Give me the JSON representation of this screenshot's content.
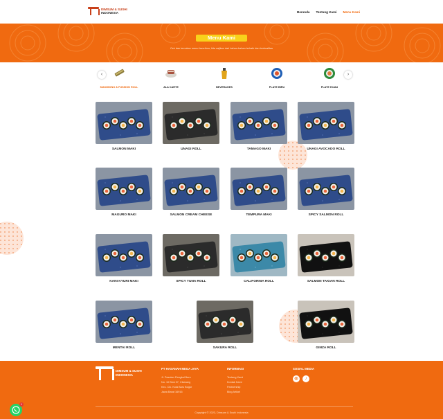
{
  "brand": {
    "line1": "DIMSUM & SUSHI",
    "line2": "INDONESIA"
  },
  "nav": [
    {
      "label": "Beranda",
      "active": false
    },
    {
      "label": "Tentang Kami",
      "active": false
    },
    {
      "label": "Menu Kami",
      "active": true
    }
  ],
  "hero": {
    "title": "Menu Kami",
    "subtitle": "Cek dan temukan menu favoritmu, kita sajikan dari bahan-bahan terbaik dan berkualitas"
  },
  "categories": [
    {
      "label": "MAKIMONO & FUSSION ROLL",
      "icon": "roll-icon",
      "active": true
    },
    {
      "label": "ALA CARTE",
      "icon": "plate-icon",
      "active": false
    },
    {
      "label": "BEVERAGES",
      "icon": "drink-icon",
      "active": false
    },
    {
      "label": "PLATE BIRU",
      "icon": "blue-plate-icon",
      "active": false
    },
    {
      "label": "PLATE HIJAU",
      "icon": "green-plate-icon",
      "active": false
    }
  ],
  "products": [
    {
      "name": "SALMON MAKI",
      "style": "blue"
    },
    {
      "name": "UNAGI ROLL",
      "style": "dark"
    },
    {
      "name": "TAMAGO MAKI",
      "style": "blue"
    },
    {
      "name": "UNAGI AVOCADO ROLL",
      "style": "blue"
    },
    {
      "name": "MAGURO MAKI",
      "style": "blue"
    },
    {
      "name": "SALMON CREAM CHEESE",
      "style": "blue"
    },
    {
      "name": "TEMPURA MAKI",
      "style": "blue"
    },
    {
      "name": "SPICY SALMON ROLL",
      "style": "blue"
    },
    {
      "name": "KANI KYURI MAKI",
      "style": "blue"
    },
    {
      "name": "SPICY TUNA ROLL",
      "style": "dark"
    },
    {
      "name": "CALIFORNIA ROLL",
      "style": "teal"
    },
    {
      "name": "SALMON TAKIAN ROLL",
      "style": "black"
    },
    {
      "name": "MENTAI ROLL",
      "style": "blue"
    },
    {
      "name": "SAKURA ROLL",
      "style": "dark"
    },
    {
      "name": "GINZA ROLL",
      "style": "black"
    }
  ],
  "footer": {
    "brand": {
      "line1": "DIMSUM & SUSHI",
      "line2": "INDONESIA"
    },
    "company": {
      "heading": "PT HASANAH MEGA JAYA",
      "lines": [
        "Jl. Pasutan Pangkal Baru",
        "No. 10 Blok 37, Cikarang",
        "Kec. Cik. Kota Baru Bogor",
        "Jawa Barat 16916"
      ]
    },
    "info": {
      "heading": "INFORMASI",
      "lines": [
        "Tentang Kami",
        "Kontak Kami",
        "Partnership",
        "Blog Artikel"
      ]
    },
    "social": {
      "heading": "SOSIAL MEDIA",
      "icons": [
        "instagram-icon",
        "tiktok-icon"
      ]
    },
    "copyright": "Copyright © 2023, Dimsum & Sushi Indonesia"
  },
  "whatsapp": {
    "badge": "1"
  },
  "colors": {
    "primary": "#f06a10",
    "accent": "#f8d21b",
    "whatsapp": "#25d366"
  }
}
